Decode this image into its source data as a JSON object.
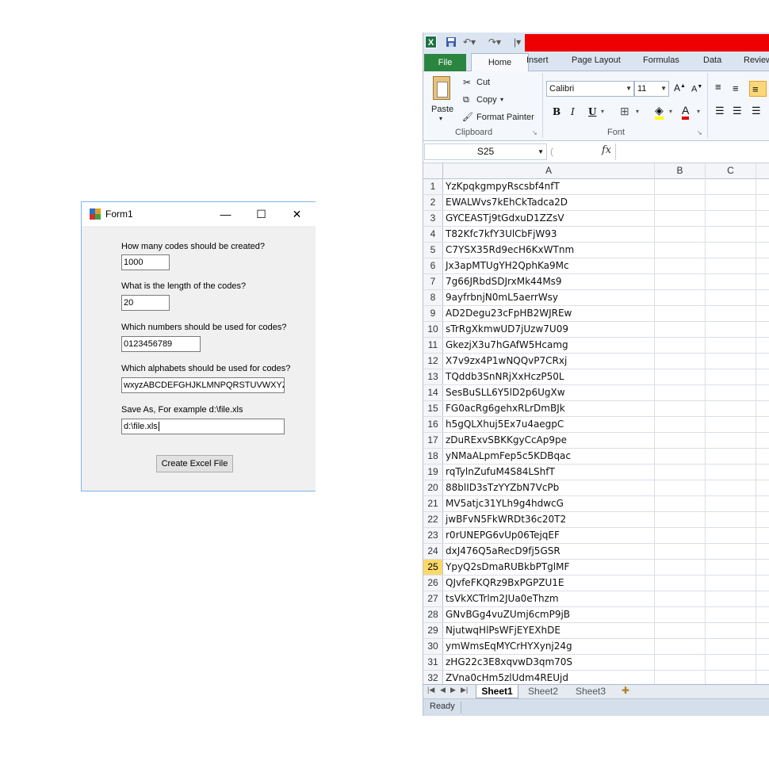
{
  "form": {
    "title": "Form1",
    "window_buttons": {
      "minimize": "—",
      "maximize": "☐",
      "close": "✕"
    },
    "fields": [
      {
        "label": "How many codes should be created?",
        "value": "1000"
      },
      {
        "label": "What is the length of the codes?",
        "value": "20"
      },
      {
        "label": "Which numbers should be used for codes?",
        "value": "0123456789"
      },
      {
        "label": "Which alphabets should be used for codes?",
        "value": "wxyzABCDEFGHJKLMNPQRSTUVWXYZ"
      },
      {
        "label": "Save As, For example d:\\file.xls",
        "value": "d:\\file.xls"
      }
    ],
    "button_label": "Create Excel File"
  },
  "excel": {
    "tabs": [
      "File",
      "Home",
      "Insert",
      "Page Layout",
      "Formulas",
      "Data",
      "Review"
    ],
    "active_tab": "Home",
    "clipboard": {
      "paste": "Paste",
      "cut": "Cut",
      "copy": "Copy",
      "format_painter": "Format Painter",
      "group_label": "Clipboard"
    },
    "font": {
      "name": "Calibri",
      "size": "11",
      "bold": "B",
      "italic": "I",
      "underline": "U",
      "group_label": "Font"
    },
    "name_box": "S25",
    "fx": "fx",
    "columns": [
      "A",
      "B",
      "C"
    ],
    "active_row": 25,
    "rows": [
      "YzKpqkgmpyRscsbf4nfT",
      "EWALWvs7kEhCkTadca2D",
      "GYCEASTj9tGdxuD1ZZsV",
      "T82Kfc7kfY3UlCbFjW93",
      "C7YSX35Rd9ecH6KxWTnm",
      "Jx3apMTUgYH2QphKa9Mc",
      "7g66JRbdSDJrxMk44Ms9",
      "9ayfrbnjN0mL5aerrWsy",
      "AD2Degu23cFpHB2WJREw",
      "sTrRgXkmwUD7jUzw7U09",
      "GkezjX3u7hGAfW5Hcamg",
      "X7v9zx4P1wNQQvP7CRxj",
      "TQddb3SnNRjXxHczP50L",
      "SesBuSLL6Y5lD2p6UgXw",
      "FG0acRg6gehxRLrDmBJk",
      "h5gQLXhuj5Ex7u4aegpC",
      "zDuRExvSBKKgyCcAp9pe",
      "yNMaALpmFep5c5KDBqac",
      "rqTylnZufuM4S84LShfT",
      "88blID3sTzYYZbN7VcPb",
      "MV5atjc31YLh9g4hdwcG",
      "jwBFvN5FkWRDt36c20T2",
      "r0rUNEPG6vUp06TejqEF",
      "dxJ476Q5aRecD9fj5GSR",
      "YpyQ2sDmaRUBkbPTglMF",
      "QJvfeFKQRz9BxPGPZU1E",
      "tsVkXCTrlm2JUa0eThzm",
      "GNvBGg4vuZUmj6cmP9jB",
      "NjutwqHlPsWFjEYEXhDE",
      "ymWmsEqMYCrHYXynj24g",
      "zHG22c3E8xqvwD3qm70S",
      "ZVna0cHm5zlUdm4REUjd"
    ],
    "sheets": [
      "Sheet1",
      "Sheet2",
      "Sheet3"
    ],
    "active_sheet": "Sheet1",
    "status": "Ready"
  }
}
